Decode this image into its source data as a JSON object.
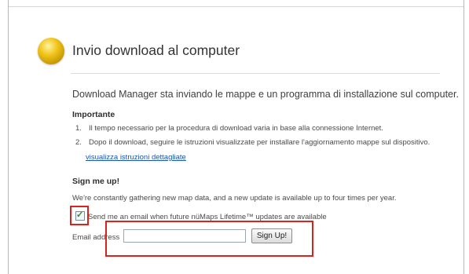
{
  "header": {
    "title": "Invio download al computer",
    "orb_color": "#e2b20d"
  },
  "main": {
    "intro": "Download Manager sta inviando le mappe e un programma di installazione sul computer.",
    "important_label": "Importante",
    "steps": [
      {
        "num": "1.",
        "text": "Il tempo necessario per la procedura di download varia in base alla connessione Internet."
      },
      {
        "num": "2.",
        "text": "Dopo il download, seguire le istruzioni visualizzate per installare l'aggiornamento mappe sul dispositivo."
      }
    ],
    "details_link": "visualizza istruzioni dettagliate"
  },
  "signup": {
    "title": "Sign me up!",
    "description": "We're constantly gathering new map data, and a new update is available up to four times per year.",
    "checkbox_checked": true,
    "checkbox_label": "Send me an email when future nüMaps Lifetime™ updates are available",
    "email_label": "Email address",
    "email_value": "",
    "button_label": "Sign Up!"
  },
  "annotations": {
    "highlight_color": "#d8231e"
  }
}
